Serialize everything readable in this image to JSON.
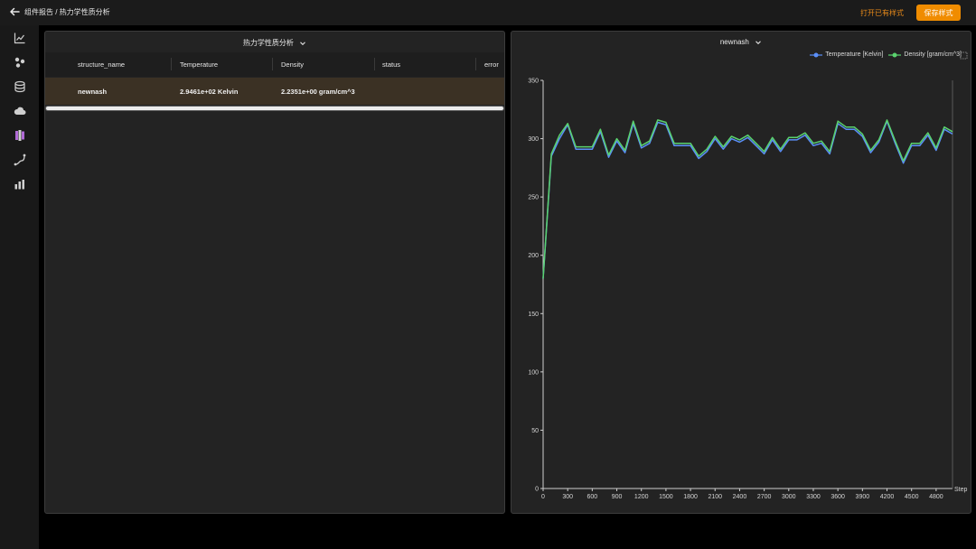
{
  "header": {
    "breadcrumb": "组件报告 / 热力学性质分析",
    "open_saved_label": "打开已有样式",
    "save_style_label": "保存样式"
  },
  "nav": {
    "icons": [
      "line-chart-icon",
      "molecule-icon",
      "database-icon",
      "cloud-icon",
      "cluster-icon",
      "path-icon",
      "bar-chart-icon"
    ]
  },
  "table_panel": {
    "title": "热力学性质分析",
    "columns": [
      "structure_name",
      "Temperature",
      "Density",
      "status",
      "error"
    ],
    "rows": [
      {
        "structure_name": "newnash",
        "temperature": "2.9461e+02 Kelvin",
        "density": "2.2351e+00 gram/cm^3",
        "status": "",
        "error": ""
      }
    ]
  },
  "chart_panel": {
    "title": "newnash",
    "legend": [
      {
        "name": "Temperature [Kelvin]",
        "color": "#5b8ff9"
      },
      {
        "name": "Density [gram/cm^3]",
        "color": "#5ad26e"
      }
    ]
  },
  "chart_data": {
    "type": "line",
    "title": "newnash",
    "xlabel": "Step",
    "ylabel": "",
    "xlim": [
      0,
      5000
    ],
    "ylim": [
      0,
      350
    ],
    "x_ticks": [
      0,
      300,
      600,
      900,
      1200,
      1500,
      1800,
      2100,
      2400,
      2700,
      3000,
      3300,
      3600,
      3900,
      4200,
      4500,
      4800
    ],
    "y_ticks": [
      0,
      50,
      100,
      150,
      200,
      250,
      300,
      350
    ],
    "legend_position": "top-right",
    "x": [
      0,
      100,
      200,
      300,
      400,
      500,
      600,
      700,
      800,
      900,
      1000,
      1100,
      1200,
      1300,
      1400,
      1500,
      1600,
      1700,
      1800,
      1900,
      2000,
      2100,
      2200,
      2300,
      2400,
      2500,
      2600,
      2700,
      2800,
      2900,
      3000,
      3100,
      3200,
      3300,
      3400,
      3500,
      3600,
      3700,
      3800,
      3900,
      4000,
      4100,
      4200,
      4300,
      4400,
      4500,
      4600,
      4700,
      4800,
      4900,
      5000
    ],
    "series": [
      {
        "name": "Temperature [Kelvin]",
        "color": "#5b8ff9",
        "values": [
          180,
          285,
          300,
          312,
          291,
          291,
          291,
          306,
          284,
          298,
          288,
          313,
          292,
          296,
          314,
          312,
          294,
          294,
          294,
          283,
          289,
          300,
          291,
          300,
          297,
          301,
          294,
          287,
          299,
          289,
          299,
          299,
          303,
          294,
          296,
          287,
          313,
          308,
          308,
          302,
          288,
          297,
          315,
          296,
          279,
          294,
          294,
          303,
          290,
          308,
          304
        ]
      },
      {
        "name": "Density [gram/cm^3]",
        "color": "#5ad26e",
        "values": [
          180,
          287,
          303,
          313,
          293,
          293,
          293,
          308,
          286,
          300,
          290,
          315,
          294,
          298,
          316,
          314,
          296,
          296,
          296,
          285,
          291,
          302,
          293,
          302,
          299,
          303,
          296,
          289,
          301,
          291,
          301,
          301,
          305,
          296,
          298,
          289,
          315,
          310,
          310,
          304,
          290,
          299,
          316,
          298,
          281,
          296,
          296,
          305,
          292,
          310,
          306
        ]
      }
    ]
  }
}
